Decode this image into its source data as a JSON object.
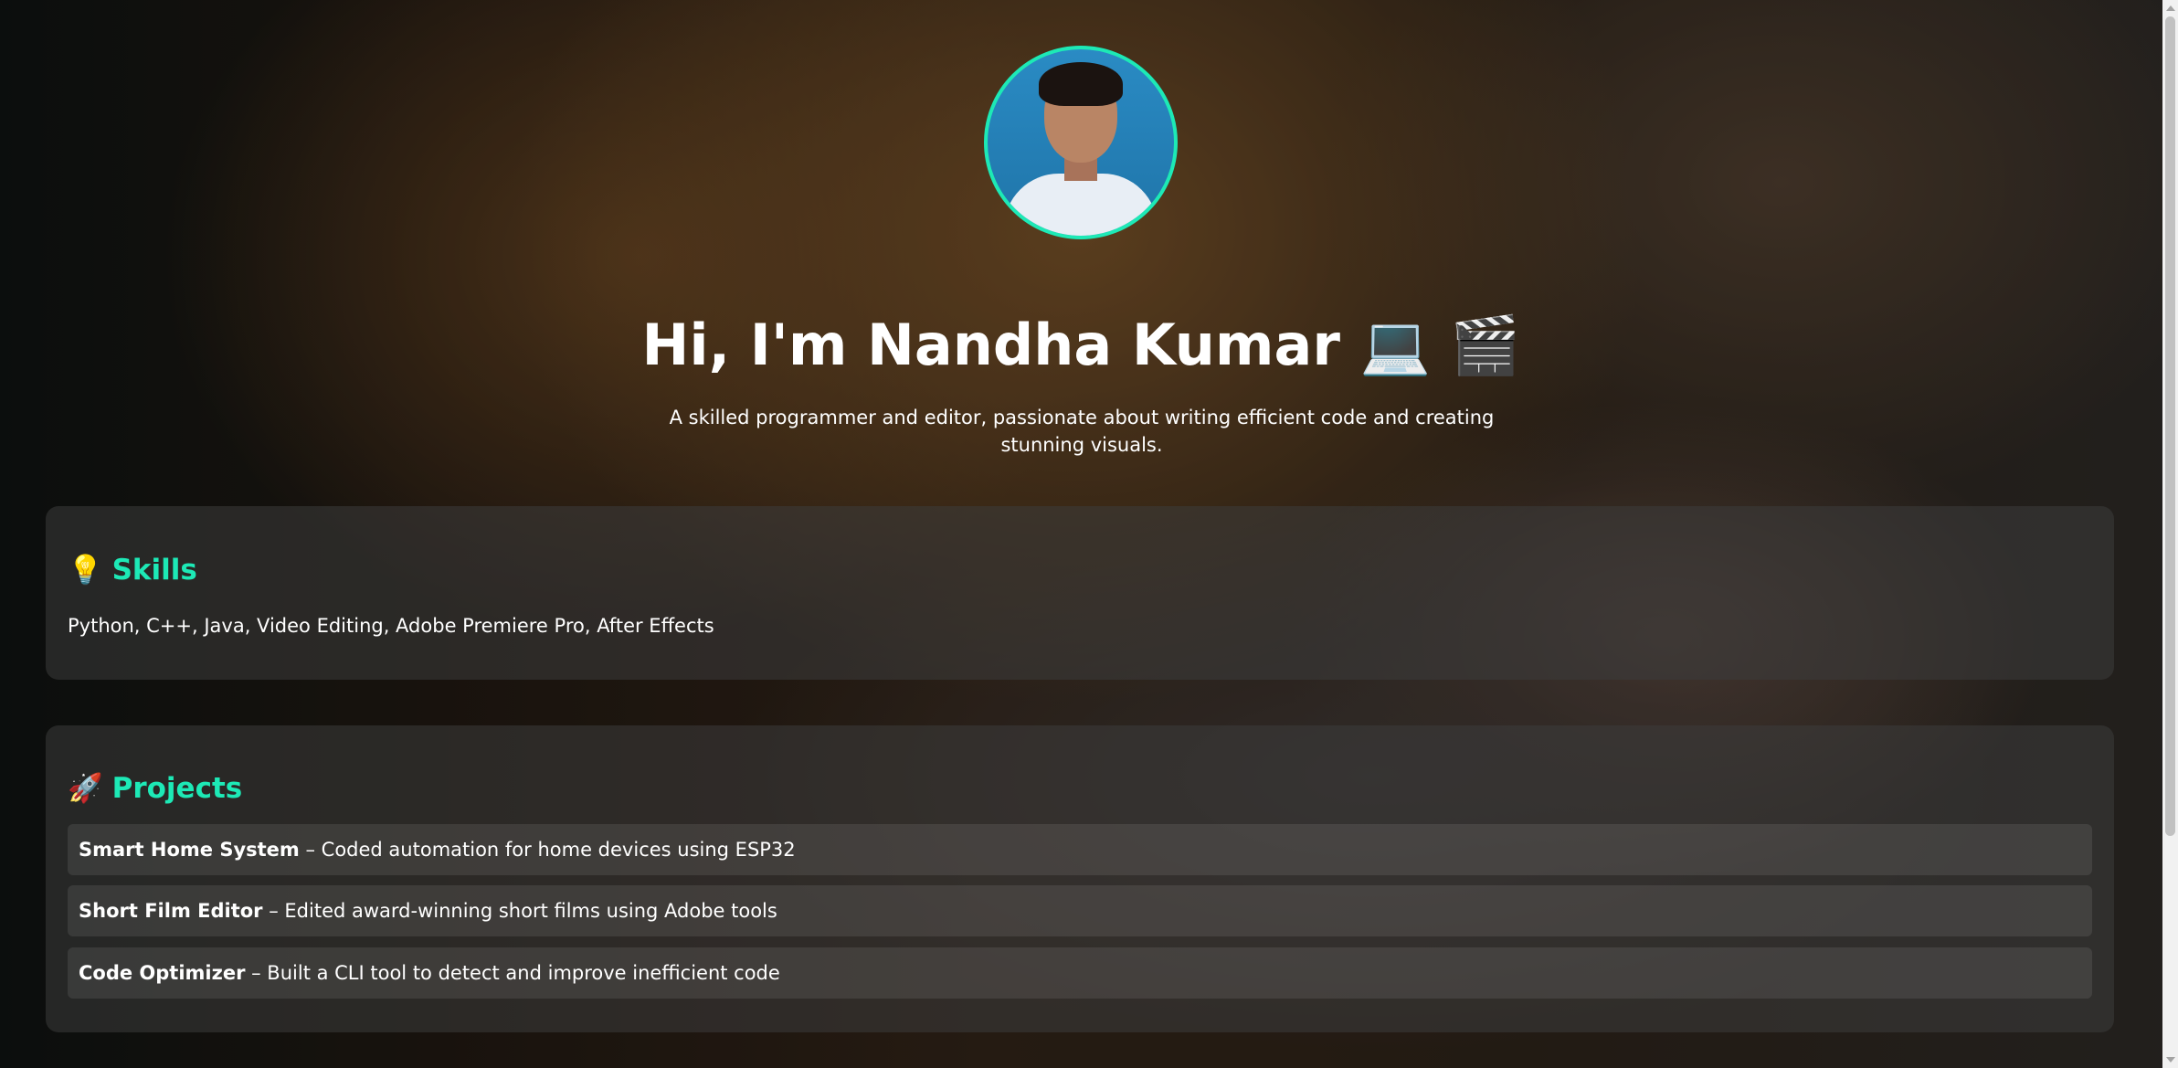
{
  "hero": {
    "title": "Hi, I'm Nandha Kumar 💻 🎬",
    "subtitle": "A skilled programmer and editor, passionate about writing efficient code and creating stunning visuals."
  },
  "skills": {
    "icon": "💡",
    "heading": "Skills",
    "text": "Python, C++, Java, Video Editing, Adobe Premiere Pro, After Effects"
  },
  "projects": {
    "icon": "🚀",
    "heading": "Projects",
    "items": [
      {
        "name": "Smart Home System",
        "description": " – Coded automation for home devices using ESP32"
      },
      {
        "name": "Short Film Editor",
        "description": " – Edited award-winning short films using Adobe tools"
      },
      {
        "name": "Code Optimizer",
        "description": " – Built a CLI tool to detect and improve inefficient code"
      }
    ]
  },
  "colors": {
    "accent": "#1de9b6",
    "text": "#ffffff"
  }
}
